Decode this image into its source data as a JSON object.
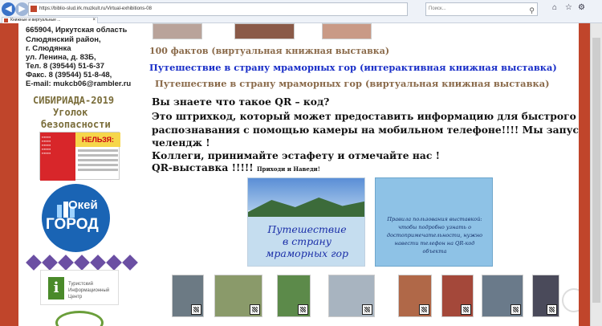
{
  "browser": {
    "url": "https://biblio-slud.irk.muzkult.ru/Virtual-exhibitions-08",
    "search_placeholder": "Поиск...",
    "tab_title": "Книжные и виртуальные ..."
  },
  "sidebar": {
    "address_lines": [
      "665904, Иркутская область",
      "Слюдянский район,",
      "г. Слюдянка",
      "ул. Ленина, д. 83Б,",
      "Тел. 8 (39544) 51-6-37",
      "Факс. 8 (39544) 51-8-48,",
      "E-mail: mukcb06@rambler.ru"
    ],
    "sibiriada_title": "СИБИРИАДА-2019",
    "ugolok": "Уголок",
    "bezopasnost": "безопасности",
    "poster_word": "НЕЛЬЗЯ:",
    "okey_top": "Окей",
    "okey_bottom": "ГОРОД",
    "tic_text": "Туристский Информационный Центр"
  },
  "main": {
    "link_facts": "100 фактов (виртуальная книжная выставка)",
    "link_interactive": "Путешествие в страну мраморных гор (интерактивная книжная выставка)",
    "link_virtual": "Путешествие в страну мраморных гор (виртуальная книжная выставка)",
    "para1": "Вы знаете что такое QR – код?",
    "para2": "Это штрихкод, который может предоставить информацию для быстрого",
    "para3": "распознавания с помощью камеры на мобильном телефоне!!!! Мы запускаем",
    "para4": "челендж !",
    "para5": "Коллеги, принимайте эстафету и отмечайте нас !",
    "para6": "QR-выставка !!!!! ",
    "para6_small": "Приходи и Наведи!",
    "poster1_line1": "Путешествие",
    "poster1_line2": "в страну",
    "poster1_line3": "мраморных гор",
    "poster2_text": "Правила пользования выставкой: чтобы подробно узнать о достопримечательности, нужно навести телефон на QR-код объекта"
  }
}
